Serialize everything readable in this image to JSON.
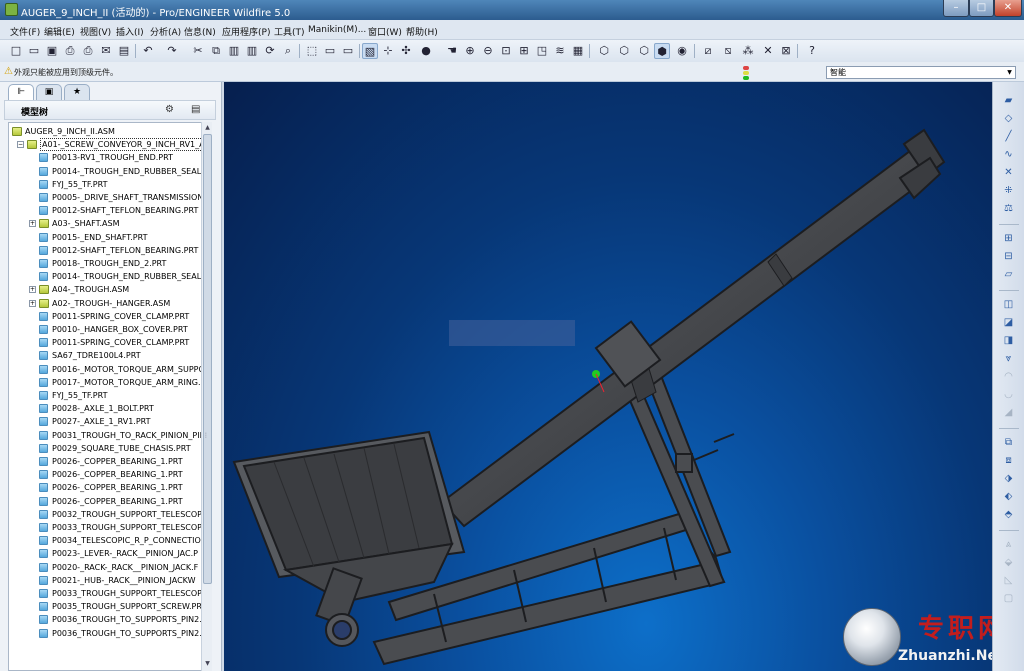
{
  "window": {
    "title": "AUGER_9_INCH_II (活动的) - Pro/ENGINEER Wildfire 5.0",
    "min": "–",
    "max": "□",
    "close": "✕"
  },
  "menu": [
    "文件(F)",
    "编辑(E)",
    "视图(V)",
    "插入(I)",
    "分析(A)",
    "信息(N)",
    "应用程序(P)",
    "工具(T)",
    "Manikin(M)...",
    "窗口(W)",
    "帮助(H)"
  ],
  "message": {
    "text": "外观只能被应用到顶级元件。"
  },
  "filter": {
    "value": "智能"
  },
  "left_panel": {
    "tree_title": "模型树",
    "tree": [
      {
        "label": "AUGER_9_INCH_II.ASM",
        "type": "asm",
        "indent": 0
      },
      {
        "label": "A01-_SCREW_CONVEYOR_9_INCH_RV1_A",
        "type": "asm",
        "indent": 1,
        "expand": "−",
        "selected": true
      },
      {
        "label": "P0013-RV1_TROUGH_END.PRT",
        "type": "prt",
        "indent": 2
      },
      {
        "label": "P0014-_TROUGH_END_RUBBER_SEAL.P",
        "type": "prt",
        "indent": 2
      },
      {
        "label": "FYJ_55_TF.PRT",
        "type": "prt",
        "indent": 2
      },
      {
        "label": "P0005-_DRIVE_SHAFT_TRANSMISSION",
        "type": "prt",
        "indent": 2
      },
      {
        "label": "P0012-SHAFT_TEFLON_BEARING.PRT",
        "type": "prt",
        "indent": 2
      },
      {
        "label": "A03-_SHAFT.ASM",
        "type": "asm",
        "indent": 2,
        "expand": "+"
      },
      {
        "label": "P0015-_END_SHAFT.PRT",
        "type": "prt",
        "indent": 2
      },
      {
        "label": "P0012-SHAFT_TEFLON_BEARING.PRT",
        "type": "prt",
        "indent": 2
      },
      {
        "label": "P0018-_TROUGH_END_2.PRT",
        "type": "prt",
        "indent": 2
      },
      {
        "label": "P0014-_TROUGH_END_RUBBER_SEAL.P",
        "type": "prt",
        "indent": 2
      },
      {
        "label": "A04-_TROUGH.ASM",
        "type": "asm",
        "indent": 2,
        "expand": "+"
      },
      {
        "label": "A02-_TROUGH-_HANGER.ASM",
        "type": "asm",
        "indent": 2,
        "expand": "+"
      },
      {
        "label": "P0011-SPRING_COVER_CLAMP.PRT",
        "type": "prt",
        "indent": 2
      },
      {
        "label": "P0010-_HANGER_BOX_COVER.PRT",
        "type": "prt",
        "indent": 2
      },
      {
        "label": "P0011-SPRING_COVER_CLAMP.PRT",
        "type": "prt",
        "indent": 2
      },
      {
        "label": "SA67_TDRE100L4.PRT",
        "type": "prt",
        "indent": 2
      },
      {
        "label": "P0016-_MOTOR_TORQUE_ARM_SUPPO",
        "type": "prt",
        "indent": 2
      },
      {
        "label": "P0017-_MOTOR_TORQUE_ARM_RING.",
        "type": "prt",
        "indent": 2
      },
      {
        "label": "FYJ_55_TF.PRT",
        "type": "prt",
        "indent": 2
      },
      {
        "label": "P0028-_AXLE_1_BOLT.PRT",
        "type": "prt",
        "indent": 2
      },
      {
        "label": "P0027-_AXLE_1_RV1.PRT",
        "type": "prt",
        "indent": 2
      },
      {
        "label": "P0031_TROUGH_TO_RACK_PINION_PIN",
        "type": "prt",
        "indent": 2
      },
      {
        "label": "P0029_SQUARE_TUBE_CHASIS.PRT",
        "type": "prt",
        "indent": 2
      },
      {
        "label": "P0026-_COPPER_BEARING_1.PRT",
        "type": "prt",
        "indent": 2
      },
      {
        "label": "P0026-_COPPER_BEARING_1.PRT",
        "type": "prt",
        "indent": 2
      },
      {
        "label": "P0026-_COPPER_BEARING_1.PRT",
        "type": "prt",
        "indent": 2
      },
      {
        "label": "P0026-_COPPER_BEARING_1.PRT",
        "type": "prt",
        "indent": 2
      },
      {
        "label": "P0032_TROUGH_SUPPORT_TELESCOPI",
        "type": "prt",
        "indent": 2
      },
      {
        "label": "P0033_TROUGH_SUPPORT_TELESCOPI",
        "type": "prt",
        "indent": 2
      },
      {
        "label": "P0034_TELESCOPIC_R_P_CONNECTION",
        "type": "prt",
        "indent": 2
      },
      {
        "label": "P0023-_LEVER-_RACK__PINION_JAC.P",
        "type": "prt",
        "indent": 2
      },
      {
        "label": "P0020-_RACK-_RACK__PINION_JACK.F",
        "type": "prt",
        "indent": 2
      },
      {
        "label": "P0021-_HUB-_RACK__PINION_JACKW",
        "type": "prt",
        "indent": 2
      },
      {
        "label": "P0033_TROUGH_SUPPORT_TELESCOPI",
        "type": "prt",
        "indent": 2
      },
      {
        "label": "P0035_TROUGH_SUPPORT_SCREW.PRT",
        "type": "prt",
        "indent": 2
      },
      {
        "label": "P0036_TROUGH_TO_SUPPORTS_PIN2.F",
        "type": "prt",
        "indent": 2
      },
      {
        "label": "P0036_TROUGH_TO_SUPPORTS_PIN2.F",
        "type": "prt",
        "indent": 2
      }
    ]
  },
  "watermark": {
    "cn": "专职网",
    "en": "Zhuanzhi.Net"
  },
  "colors": {
    "viewport_mid": "#0a50a0",
    "model_body": "#4a4c50",
    "model_edge": "#1c1d20",
    "accent_green": "#22cc22"
  }
}
